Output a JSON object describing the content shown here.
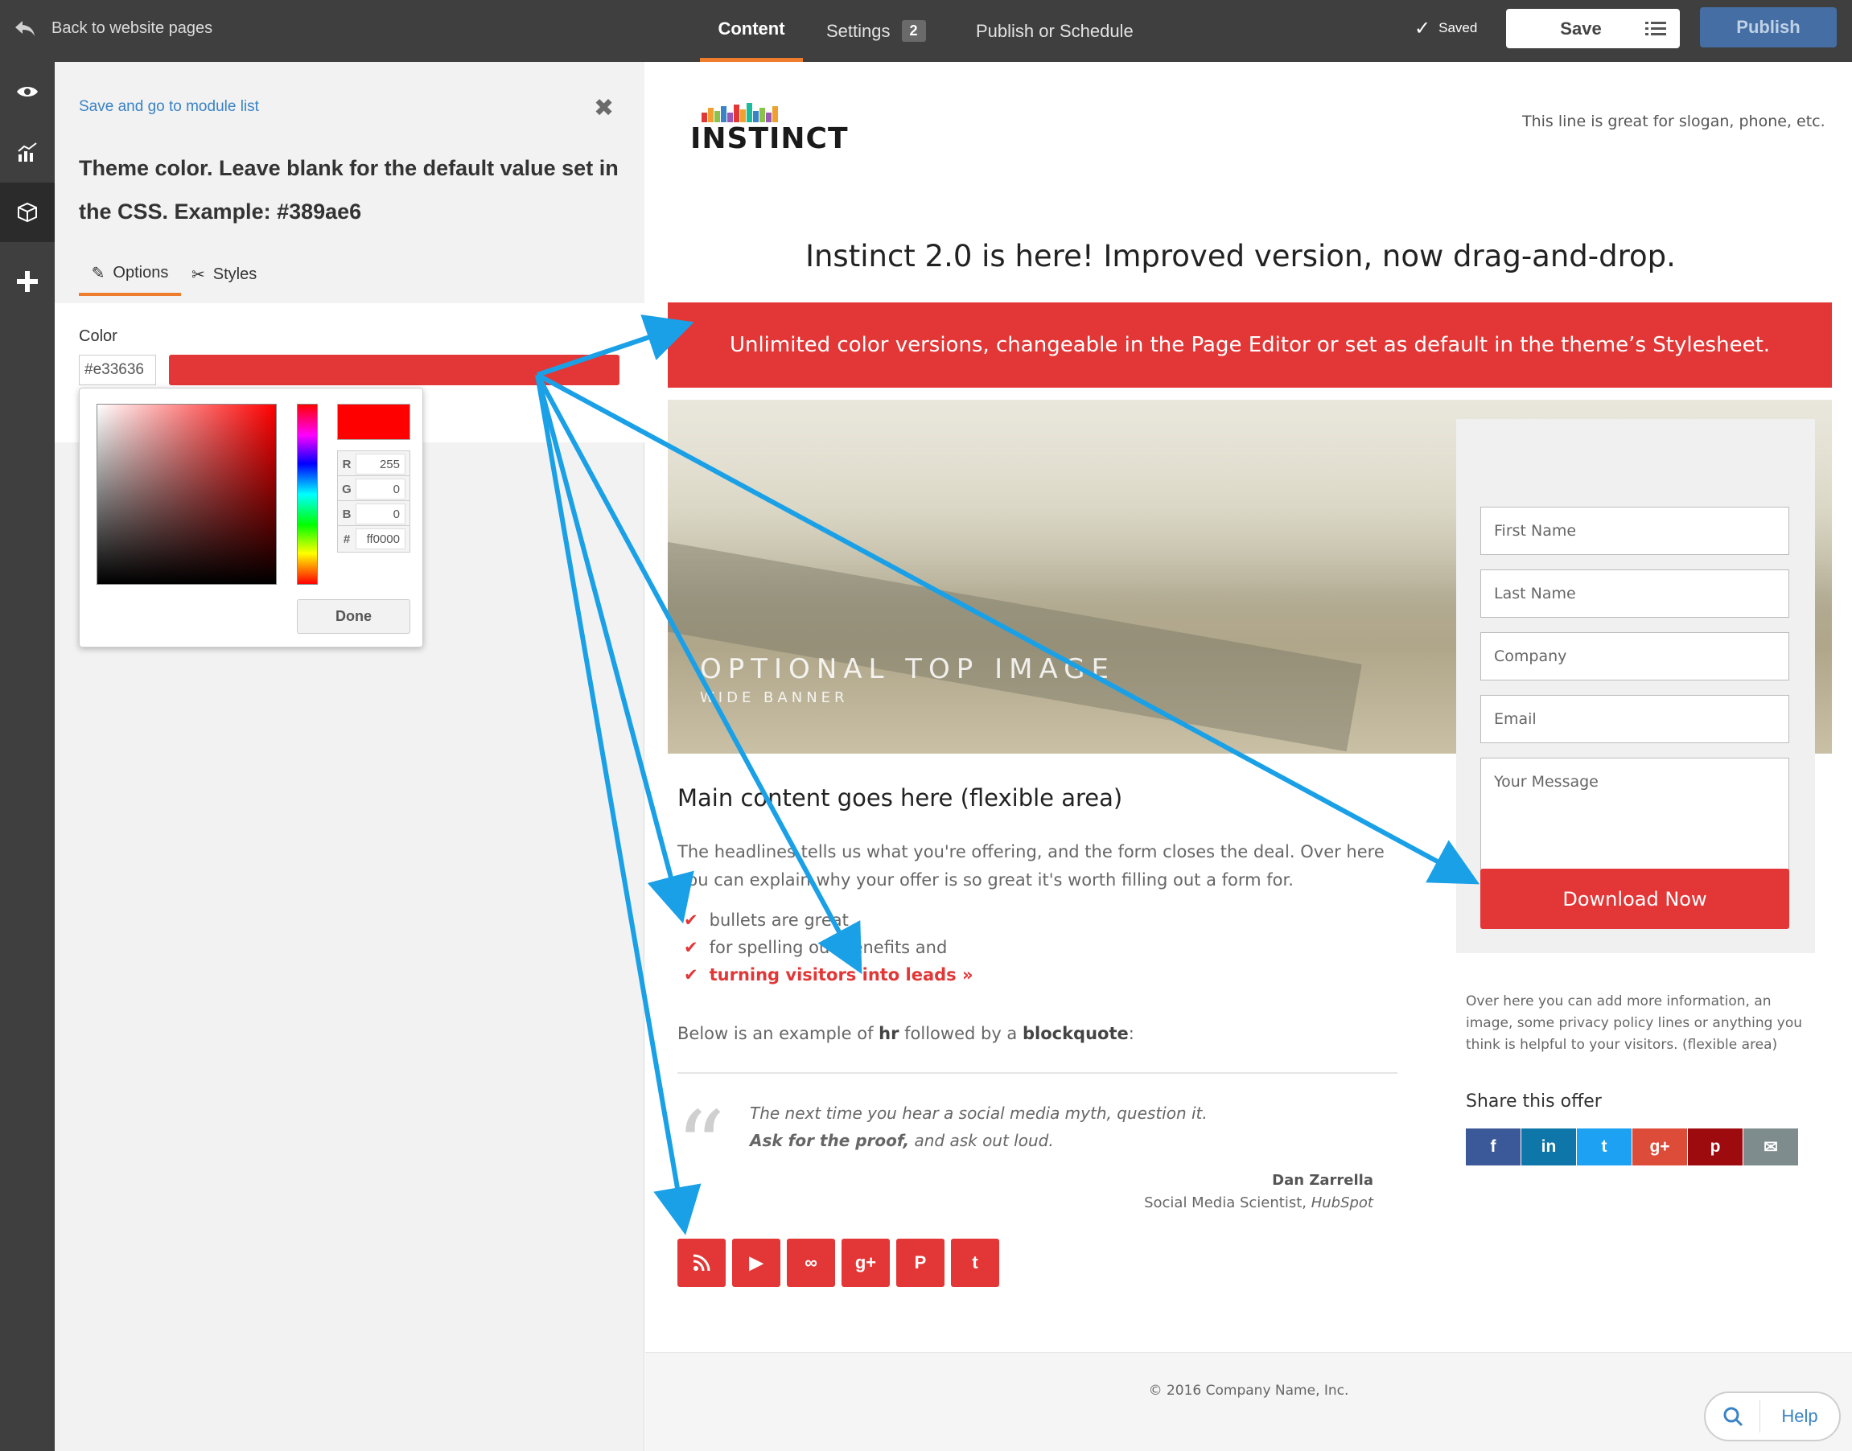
{
  "topbar": {
    "back_label": "Back to website pages",
    "tabs": [
      {
        "label": "Content"
      },
      {
        "label": "Settings",
        "badge": "2"
      },
      {
        "label": "Publish or Schedule"
      }
    ],
    "saved_label": "Saved",
    "save_label": "Save",
    "publish_label": "Publish"
  },
  "rail": {
    "icons": [
      "eye-icon",
      "chart-icon",
      "cube-icon",
      "plus-icon"
    ]
  },
  "panel": {
    "save_link": "Save and go to module list",
    "title": "Theme color. Leave blank for the default value set in the CSS. Example: #389ae6",
    "tab_options": "Options",
    "tab_styles": "Styles",
    "color_label": "Color",
    "color_value": "#e33636",
    "swatch_color": "#e33636"
  },
  "picker": {
    "r_label": "R",
    "r_value": "255",
    "g_label": "G",
    "g_value": "0",
    "b_label": "B",
    "b_value": "0",
    "hex_label": "#",
    "hex_value": "ff0000",
    "done_label": "Done",
    "preview_color": "#ff0000"
  },
  "page": {
    "logo_text": "INSTINCT",
    "slogan": "This line is great for slogan, phone, etc.",
    "headline": "Instinct 2.0 is here! Improved version, now drag-and-drop.",
    "banner": "Unlimited color versions, changeable in the Page Editor or set as default in the theme’s Stylesheet.",
    "banner_color": "#e33636",
    "hero_title": "OPTIONAL TOP IMAGE",
    "hero_subtitle": "WIDE BANNER",
    "main_heading": "Main content goes here (flexible area)",
    "main_paragraph": "The headlines tells us what you're offering, and the form closes the deal. Over here you can explain why your offer is so great it's worth filling out a form for.",
    "bullets": [
      "bullets are great",
      "for spelling out benefits and",
      "turning visitors into leads »"
    ],
    "below_pre": "Below is an example of ",
    "below_hr": "hr",
    "below_mid": " followed by a ",
    "below_bq": "blockquote",
    "below_post": ":",
    "quote_line1": "The next time you hear a social media myth, question it.",
    "quote_bold": "Ask for the proof,",
    "quote_line2": " and ask out loud.",
    "quote_author": "Dan Zarrella",
    "quote_role_pre": "Social Media Scientist, ",
    "quote_role_company": "HubSpot",
    "social_icons": [
      "rss-icon",
      "youtube-icon",
      "link-icon",
      "google-plus-icon",
      "pinterest-icon",
      "twitter-icon"
    ],
    "footer": "© 2016 Company Name, Inc."
  },
  "form": {
    "first_name": "First Name",
    "last_name": "Last Name",
    "company": "Company",
    "email": "Email",
    "message": "Your Message",
    "submit": "Download Now",
    "aside": "Over here you can add more information, an image, some privacy policy lines or anything you think is helpful to your visitors. (flexible area)",
    "share_title": "Share this offer",
    "share_buttons": [
      {
        "icon": "facebook-icon",
        "glyph": "f",
        "color": "#3b5998"
      },
      {
        "icon": "linkedin-icon",
        "glyph": "in",
        "color": "#0e76a8"
      },
      {
        "icon": "twitter-icon",
        "glyph": "t",
        "color": "#1da1f2"
      },
      {
        "icon": "google-plus-icon",
        "glyph": "g+",
        "color": "#dd4b39"
      },
      {
        "icon": "pinterest-icon",
        "glyph": "p",
        "color": "#9e0b0f"
      },
      {
        "icon": "email-icon",
        "glyph": "✉",
        "color": "#7f8c8d"
      }
    ]
  },
  "help": {
    "label": "Help"
  },
  "colors": {
    "accent": "#e33636",
    "annotation_arrow": "#1aa0e6",
    "publish_blue": "#456fa4",
    "tab_underline": "#f07c2e"
  }
}
